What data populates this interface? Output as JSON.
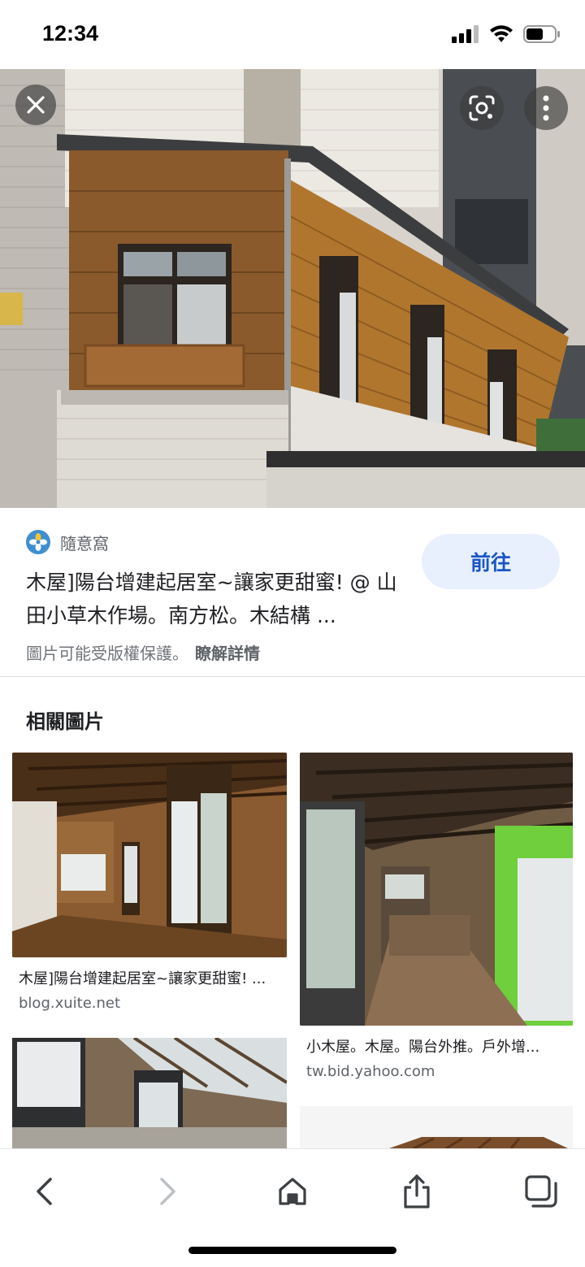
{
  "status": {
    "time": "12:34"
  },
  "source": {
    "name": "隨意窩",
    "icon": "xuite-flower-icon"
  },
  "result": {
    "title": "木屋]陽台增建起居室~讓家更甜蜜! @ 山田小草木作場。南方松。木結構 ...",
    "visit_label": "前往",
    "copyright": "圖片可能受版權保護。",
    "learn_more": "瞭解詳情"
  },
  "related": {
    "heading": "相關圖片",
    "items": [
      {
        "caption": "木屋]陽台增建起居室~讓家更甜蜜! ...",
        "domain": "blog.xuite.net"
      },
      {
        "caption": "小木屋。木屋。陽台外推。戶外增...",
        "domain": "tw.bid.yahoo.com"
      }
    ]
  },
  "icons": {
    "close": "close-icon",
    "lens": "lens-icon",
    "more": "more-vertical-icon",
    "back": "back-icon",
    "forward": "forward-icon",
    "home": "home-icon",
    "share": "share-icon",
    "tabs": "tabs-icon"
  }
}
